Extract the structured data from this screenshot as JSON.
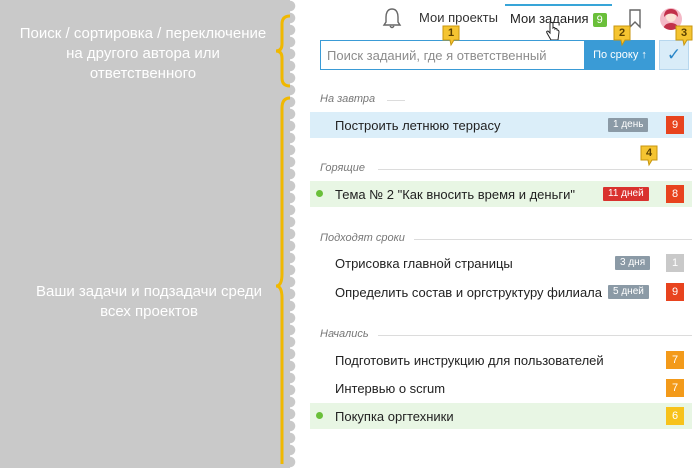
{
  "annotations": {
    "note_top": "Поиск / сортировка / переключение на другого автора или ответственного",
    "note_bottom": "Ваши задачи и подзадачи среди всех проектов",
    "markers": [
      "1",
      "2",
      "3",
      "4"
    ]
  },
  "topbar": {
    "projects_label": "Мои проекты",
    "mytasks_label": "Мои задания",
    "mytasks_badge": "9"
  },
  "search": {
    "placeholder": "Поиск заданий, где я ответственный",
    "sort_label": "По сроку ↑"
  },
  "sections": [
    {
      "title": "На завтра",
      "tasks": [
        {
          "title": "Построить летнюю террасу",
          "due": "1 день",
          "priority": "9",
          "highlight": "blue"
        }
      ]
    },
    {
      "title": "Горящие",
      "tasks": [
        {
          "title": "Тема № 2 \"Как вносить время и деньги\"",
          "due": "11 дней",
          "priority": "8",
          "highlight": "green"
        }
      ]
    },
    {
      "title": "Подходят сроки",
      "tasks": [
        {
          "title": "Отрисовка главной страницы",
          "due": "3 дня",
          "priority": "1"
        },
        {
          "title": "Определить состав и оргструктуру филиала",
          "due": "5 дней",
          "priority": "9"
        }
      ]
    },
    {
      "title": "Начались",
      "tasks": [
        {
          "title": "Подготовить инструкцию для пользователей",
          "priority": "7"
        },
        {
          "title": "Интервью о scrum",
          "priority": "7"
        },
        {
          "title": "Покупка оргтехники",
          "priority": "6",
          "highlight": "green"
        }
      ]
    }
  ],
  "colors": {
    "accent": "#3a9bd6",
    "due_gray": "#8b9aa6",
    "due_red": "#d9322e",
    "prio_red": "#e8431e",
    "prio_orange": "#f39a1a",
    "prio_yellow": "#f7c21b",
    "prio_gray": "#c9c9c9",
    "marker": "#f5c431"
  }
}
